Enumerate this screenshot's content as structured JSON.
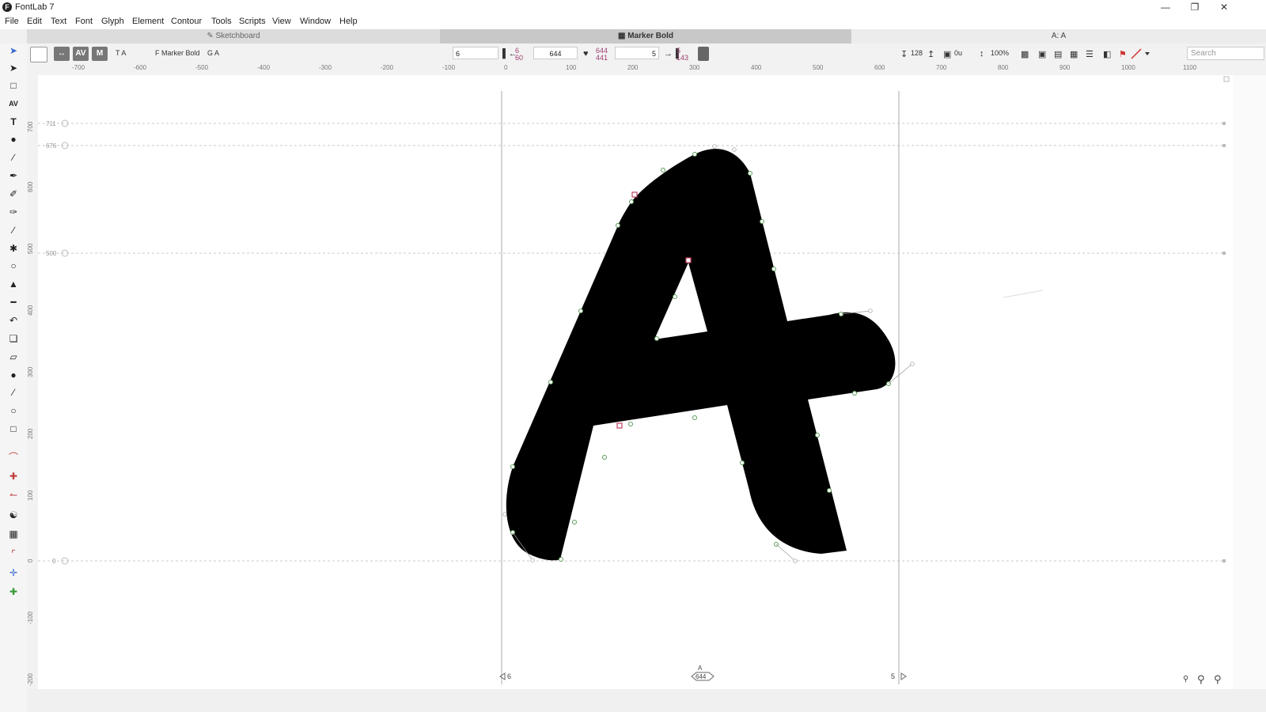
{
  "app": {
    "title": "FontLab 7"
  },
  "window_controls": [
    "minimize",
    "restore",
    "close"
  ],
  "menu": [
    "File",
    "Edit",
    "Text",
    "Font",
    "Glyph",
    "Element",
    "Contour",
    "Tools",
    "Scripts",
    "View",
    "Window",
    "Help"
  ],
  "tabs": {
    "sketchboard": "Sketchboard",
    "font": "Marker Bold",
    "glyph": "A: A"
  },
  "toolbar": {
    "text_mode": "T A",
    "font_name": "F Marker Bold",
    "glyph_label": "G A",
    "lsb_value": "6",
    "lsb_sub_top": "6",
    "lsb_sub_bottom": "60",
    "width_value": "644",
    "width_sub_top": "644",
    "width_sub_bottom": "441",
    "rsb_value": "5",
    "rsb_sub_top": "5",
    "rsb_sub_bottom": "143",
    "upm": "128",
    "units_value": "0u",
    "zoom": "100%",
    "search_placeholder": "Search"
  },
  "ruler": {
    "horizontal": [
      "-700",
      "-600",
      "-500",
      "-400",
      "-300",
      "-200",
      "-100",
      "0",
      "100",
      "200",
      "300",
      "400",
      "500",
      "600",
      "700",
      "800",
      "900",
      "1000",
      "1100"
    ],
    "vertical": [
      "700",
      "600",
      "500",
      "400",
      "300",
      "200",
      "100",
      "0",
      "-100",
      "-200"
    ]
  },
  "guides": {
    "ascender": "711",
    "cap_height": "676",
    "x_height": "500",
    "baseline": "0"
  },
  "metrics_footer": {
    "left": "6",
    "glyph_name": "A",
    "advance_width": "644",
    "right": "5"
  },
  "colors": {
    "glyph_fill": "#000000",
    "node": "#5a9a5a",
    "selected_node": "#c04060",
    "guide": "#bbbbbb",
    "accent_red": "#d03030"
  },
  "icons": [
    "select-arrow-icon",
    "contour-arrow-icon",
    "rect-select-icon",
    "kerning-icon",
    "text-icon",
    "eraser-icon",
    "brush-icon",
    "pen-icon",
    "pencil-icon",
    "rapid-icon",
    "knife-icon",
    "spiral-icon",
    "fill-icon",
    "ruler-icon",
    "curve-icon",
    "transform-icon",
    "shear-icon",
    "hand-icon",
    "eyedropper-icon",
    "ellipse-icon",
    "rectangle-icon",
    "smooth-icon",
    "tangent-icon",
    "harmonize-icon",
    "yin-yang-icon",
    "grid-icon",
    "gradient-icon",
    "guide-icon",
    "pin-icon",
    "zoom-out-icon",
    "zoom-icon",
    "zoom-fit-icon"
  ]
}
